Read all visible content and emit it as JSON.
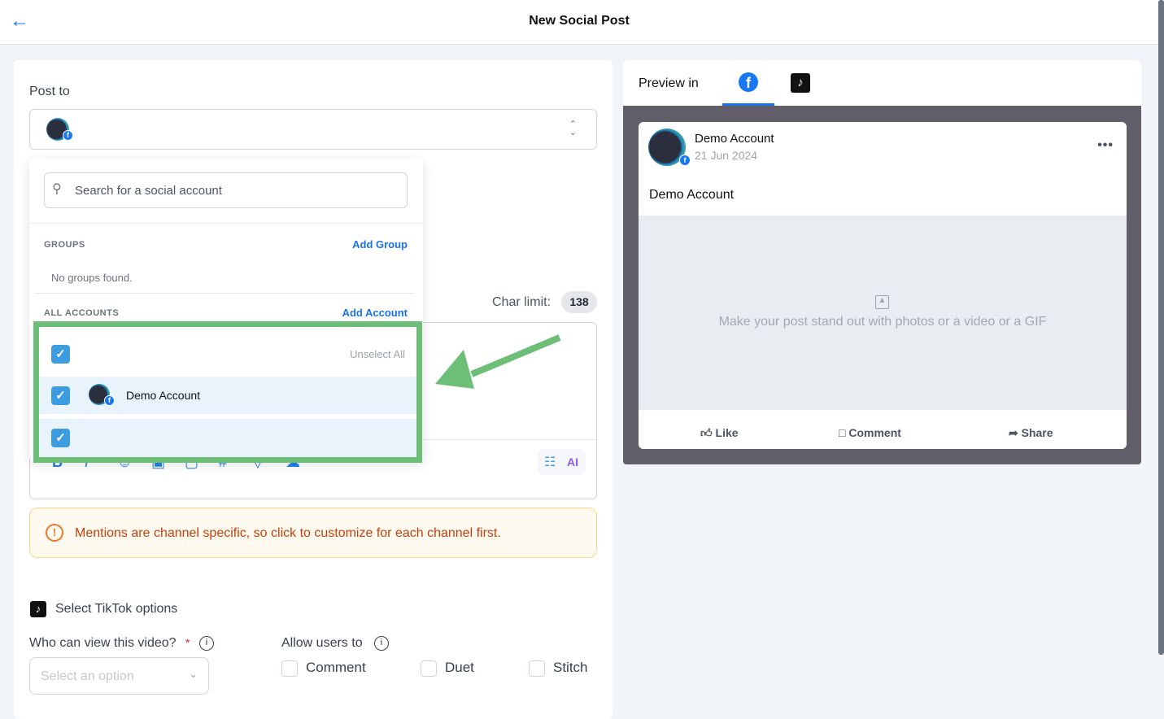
{
  "header": {
    "title": "New Social Post"
  },
  "post_to": {
    "label": "Post to"
  },
  "dropdown": {
    "search_placeholder": "Search for a social account",
    "groups_label": "GROUPS",
    "add_group": "Add Group",
    "no_groups": "No groups found.",
    "all_accounts_label": "ALL ACCOUNTS",
    "add_account": "Add Account",
    "unselect_all": "Unselect All",
    "accounts": [
      {
        "name": "Demo Account",
        "checked": true
      },
      {
        "name": "",
        "checked": true
      }
    ]
  },
  "editor": {
    "char_limit_label": "Char limit:",
    "char_limit": "138",
    "ai_label": "AI"
  },
  "warning": {
    "text": "Mentions are channel specific, so click to customize for each channel first."
  },
  "tiktok": {
    "title": "Select TikTok options",
    "who_label": "Who can view this video?",
    "required": "*",
    "select_placeholder": "Select an option",
    "allow_label": "Allow users to",
    "options": [
      "Comment",
      "Duet",
      "Stitch"
    ]
  },
  "preview": {
    "label": "Preview in",
    "tabs": [
      "facebook",
      "tiktok"
    ],
    "active_tab": "facebook",
    "account": "Demo Account",
    "date": "21 Jun 2024",
    "text": "Demo Account",
    "media_hint": "Make your post stand out with photos or a video or a GIF",
    "actions": [
      "Like",
      "Comment",
      "Share"
    ]
  },
  "colors": {
    "accent": "#1a73e8",
    "highlight": "#6dbf78",
    "warning": "#c2410c"
  }
}
